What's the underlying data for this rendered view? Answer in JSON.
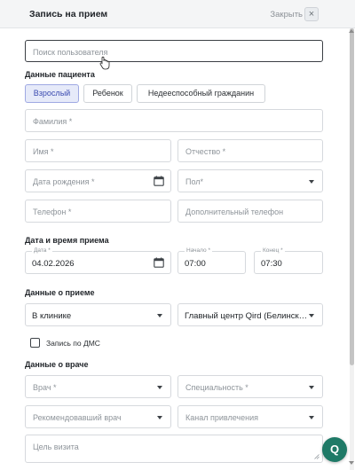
{
  "header": {
    "title": "Запись на прием",
    "close_label": "Закрыть",
    "close_glyph": "×"
  },
  "search": {
    "placeholder": "Поиск пользователя"
  },
  "patient": {
    "section_title": "Данные пациента",
    "types": [
      "Взрослый",
      "Ребенок",
      "Недееспособный гражданин"
    ],
    "active_type": "Взрослый",
    "last_name": "Фамилия *",
    "first_name": "Имя *",
    "middle_name": "Отчество *",
    "birth_date": "Дата рождения *",
    "gender": "Пол*",
    "phone": "Телефон *",
    "extra_phone": "Дополнительный телефон"
  },
  "schedule": {
    "section_title": "Дата и время приема",
    "date_label": "Дата *",
    "date_value": "04.02.2026",
    "start_label": "Начало *",
    "start_value": "07:00",
    "end_label": "Конец *",
    "end_value": "07:30"
  },
  "appointment": {
    "section_title": "Данные о приеме",
    "location_value": "В клинике",
    "branch_value": "Главный центр Qird (Белинск…",
    "dms_label": "Запись по ДМС",
    "dms_checked": false
  },
  "doctor": {
    "section_title": "Данные о враче",
    "doctor": "Врач *",
    "specialty": "Специальность *",
    "referrer": "Рекомендовавший врач",
    "channel": "Канал привлечения",
    "visit_purpose": "Цель визита"
  },
  "fab": {
    "label": "Q",
    "color": "#1f7a67"
  },
  "colors": {
    "accent": "#3b4bb0",
    "accent_bg": "#e6eaf9",
    "border": "#d6d9dd"
  }
}
